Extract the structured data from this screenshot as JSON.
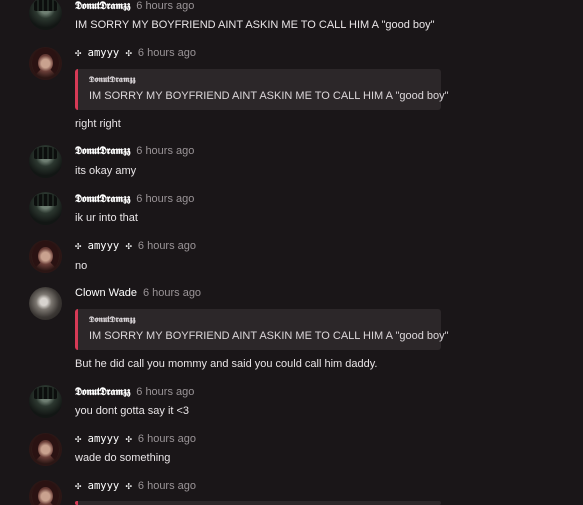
{
  "users": {
    "donut": "𝕯𝖔𝖓𝖚𝖙𝕯𝖗𝖆𝖒𝖟𝖟",
    "amy": "✣ 𝚊𝚖𝚢𝚢𝚢 ✣",
    "wade": "Clown Wade"
  },
  "messages": [
    {
      "author": "𝕯𝖔𝖓𝖚𝖙𝕯𝖗𝖆𝖒𝖟𝖟",
      "time": "6 hours ago",
      "text": "IM SORRY MY BOYFRIEND AINT ASKIN ME TO CALL HIM A \"good boy\""
    },
    {
      "author": "✣ 𝚊𝚖𝚢𝚢𝚢 ✣",
      "time": "6 hours ago",
      "quote": {
        "author": "𝕯𝖔𝖓𝖚𝖙𝕯𝖗𝖆𝖒𝖟𝖟",
        "text": "IM SORRY MY BOYFRIEND AINT ASKIN ME TO CALL HIM A \"good boy\""
      },
      "text": "right right"
    },
    {
      "author": "𝕯𝖔𝖓𝖚𝖙𝕯𝖗𝖆𝖒𝖟𝖟",
      "time": "6 hours ago",
      "text": "its okay amy"
    },
    {
      "author": "𝕯𝖔𝖓𝖚𝖙𝕯𝖗𝖆𝖒𝖟𝖟",
      "time": "6 hours ago",
      "text": "ik ur into that"
    },
    {
      "author": "✣ 𝚊𝚖𝚢𝚢𝚢 ✣",
      "time": "6 hours ago",
      "text": "no"
    },
    {
      "author": "Clown Wade",
      "time": "6 hours ago",
      "quote": {
        "author": "𝕯𝖔𝖓𝖚𝖙𝕯𝖗𝖆𝖒𝖟𝖟",
        "text": "IM SORRY MY BOYFRIEND AINT ASKIN ME TO CALL HIM A \"good boy\""
      },
      "text": "But he did call you mommy and said you could call him daddy."
    },
    {
      "author": "𝕯𝖔𝖓𝖚𝖙𝕯𝖗𝖆𝖒𝖟𝖟",
      "time": "6 hours ago",
      "text": "you dont gotta say it <3"
    },
    {
      "author": "✣ 𝚊𝚖𝚢𝚢𝚢 ✣",
      "time": "6 hours ago",
      "text": "wade do something"
    },
    {
      "author": "✣ 𝚊𝚖𝚢𝚢𝚢 ✣",
      "time": "6 hours ago",
      "text": ""
    }
  ]
}
